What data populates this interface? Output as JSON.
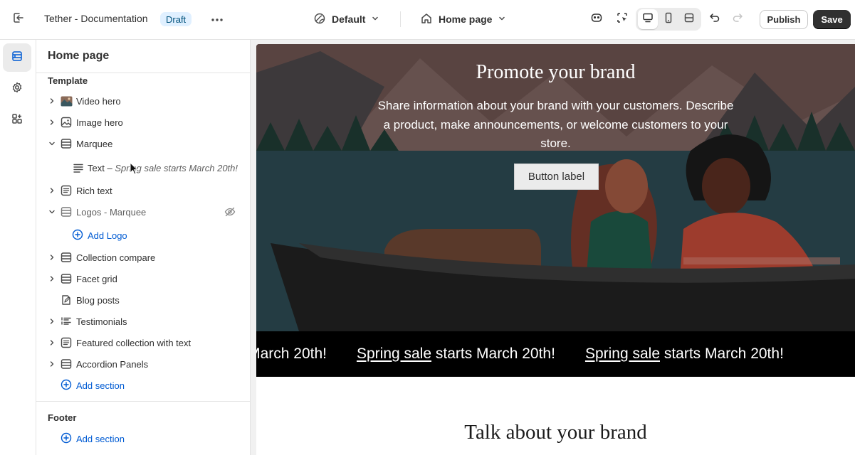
{
  "topbar": {
    "theme_name": "Tether - Documentation",
    "draft_badge": "Draft",
    "preset_label": "Default",
    "page_label": "Home page",
    "publish_label": "Publish",
    "save_label": "Save"
  },
  "icons": {
    "exit": "exit-icon",
    "more": "more-horizontal-icon",
    "preset": "theme-globe-icon",
    "page": "home-icon",
    "ai": "sidekick-icon",
    "inspector": "inspector-icon",
    "desktop": "desktop-icon",
    "mobile": "mobile-icon",
    "fullscreen": "fullscreen-icon",
    "undo": "undo-icon",
    "redo": "redo-icon"
  },
  "rail": {
    "items": [
      {
        "name": "sections",
        "icon": "layout-sections-icon",
        "active": true
      },
      {
        "name": "theme-settings",
        "icon": "gear-icon",
        "active": false
      },
      {
        "name": "apps",
        "icon": "app-blocks-icon",
        "active": false
      }
    ]
  },
  "sidebar": {
    "title": "Home page",
    "template_label": "Template",
    "sections": [
      {
        "label": "Video hero",
        "icon": "video-thumb-icon",
        "expandable": true,
        "expanded": false
      },
      {
        "label": "Image hero",
        "icon": "image-icon",
        "expandable": true,
        "expanded": false
      },
      {
        "label": "Marquee",
        "icon": "section-icon",
        "expandable": true,
        "expanded": true
      },
      {
        "label": "Rich text",
        "icon": "text-block-icon",
        "expandable": true,
        "expanded": false
      },
      {
        "label": "Logos - Marquee",
        "icon": "section-icon",
        "expandable": true,
        "expanded": true,
        "hidden": true
      },
      {
        "label": "Collection compare",
        "icon": "section-icon",
        "expandable": true,
        "expanded": false
      },
      {
        "label": "Facet grid",
        "icon": "section-icon",
        "expandable": true,
        "expanded": false
      },
      {
        "label": "Blog posts",
        "icon": "blog-icon",
        "expandable": false,
        "expanded": false
      },
      {
        "label": "Testimonials",
        "icon": "list-icon",
        "expandable": true,
        "expanded": false
      },
      {
        "label": "Featured collection with text",
        "icon": "text-block-icon",
        "expandable": true,
        "expanded": false
      },
      {
        "label": "Accordion Panels",
        "icon": "section-icon",
        "expandable": true,
        "expanded": false
      }
    ],
    "marquee_block": {
      "prefix": "Text –",
      "detail": "Spring sale starts March 20th!"
    },
    "add_logo_label": "Add Logo",
    "add_section_label": "Add section",
    "footer_label": "Footer",
    "footer_add_section_label": "Add section"
  },
  "preview": {
    "hero_title": "Promote your brand",
    "hero_text": "Share information about your brand with your customers. Describe a product, make announcements, or welcome customers to your store.",
    "hero_button": "Button label",
    "marquee_fragment": "arch 20th!",
    "marquee_link": "Spring sale",
    "marquee_rest": "starts March 20th!",
    "talk_title": "Talk about your brand"
  },
  "colors": {
    "accent_blue": "#005bd3",
    "draft_bg": "#e0f0ff",
    "draft_text": "#00527c",
    "save_bg": "#303030",
    "marquee_bg": "#000000",
    "hero_water": "#2c4a52"
  }
}
